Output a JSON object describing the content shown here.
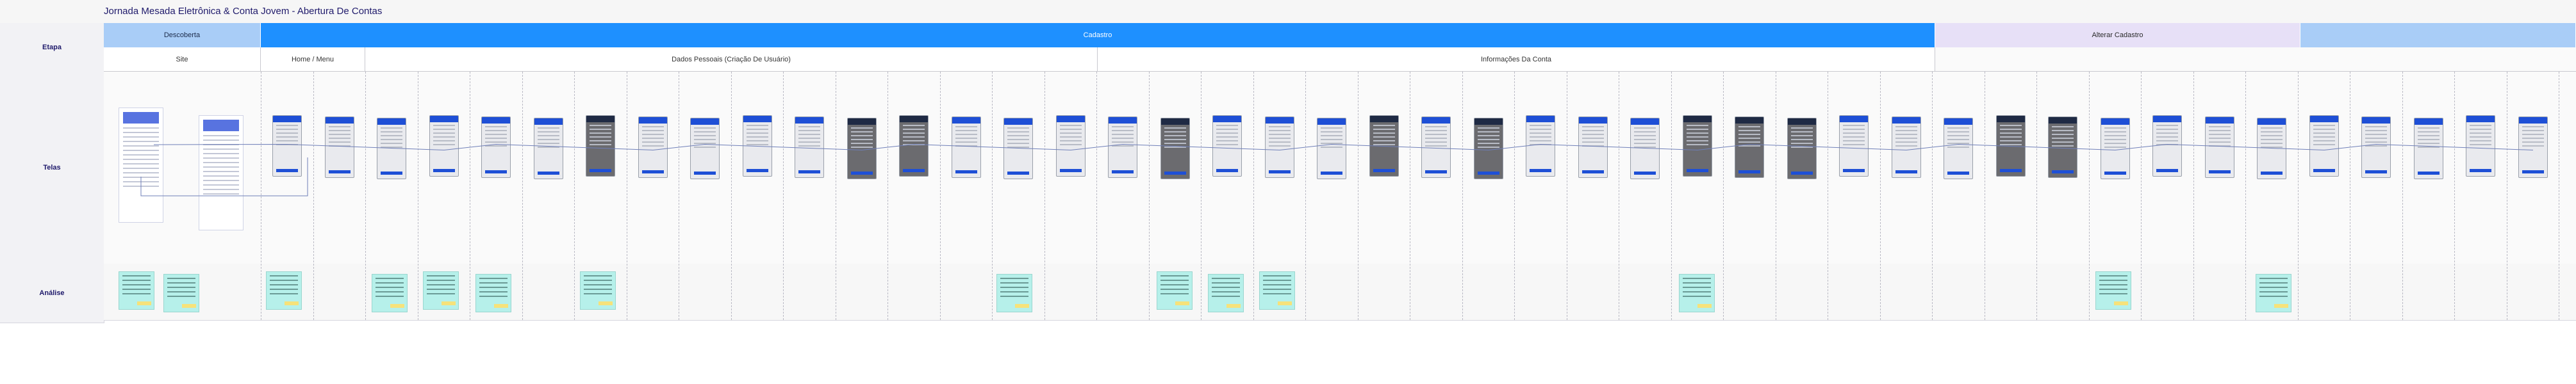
{
  "title": "Jornada Mesada Eletrônica & Conta Jovem - Abertura De Contas",
  "rows": {
    "etapa": "Etapa",
    "telas": "Telas",
    "analise": "Análise"
  },
  "stages": [
    {
      "label": "Descoberta",
      "color": "#a9cdf7",
      "text": "#1b2a4a"
    },
    {
      "label": "Cadastro",
      "color": "#1e90ff",
      "text": "#ffffff"
    },
    {
      "label": "Alterar Cadastro",
      "color": "#e7e0f7",
      "text": "#2a2a2a"
    },
    {
      "label": "",
      "color": "#a9cdf7",
      "text": "#1b2a4a"
    }
  ],
  "substages": [
    {
      "label": "Site"
    },
    {
      "label": "Home / Menu"
    },
    {
      "label": "Dados Pessoais (Criação De Usuário)"
    },
    {
      "label": "Informações Da Conta"
    },
    {
      "label": ""
    }
  ]
}
